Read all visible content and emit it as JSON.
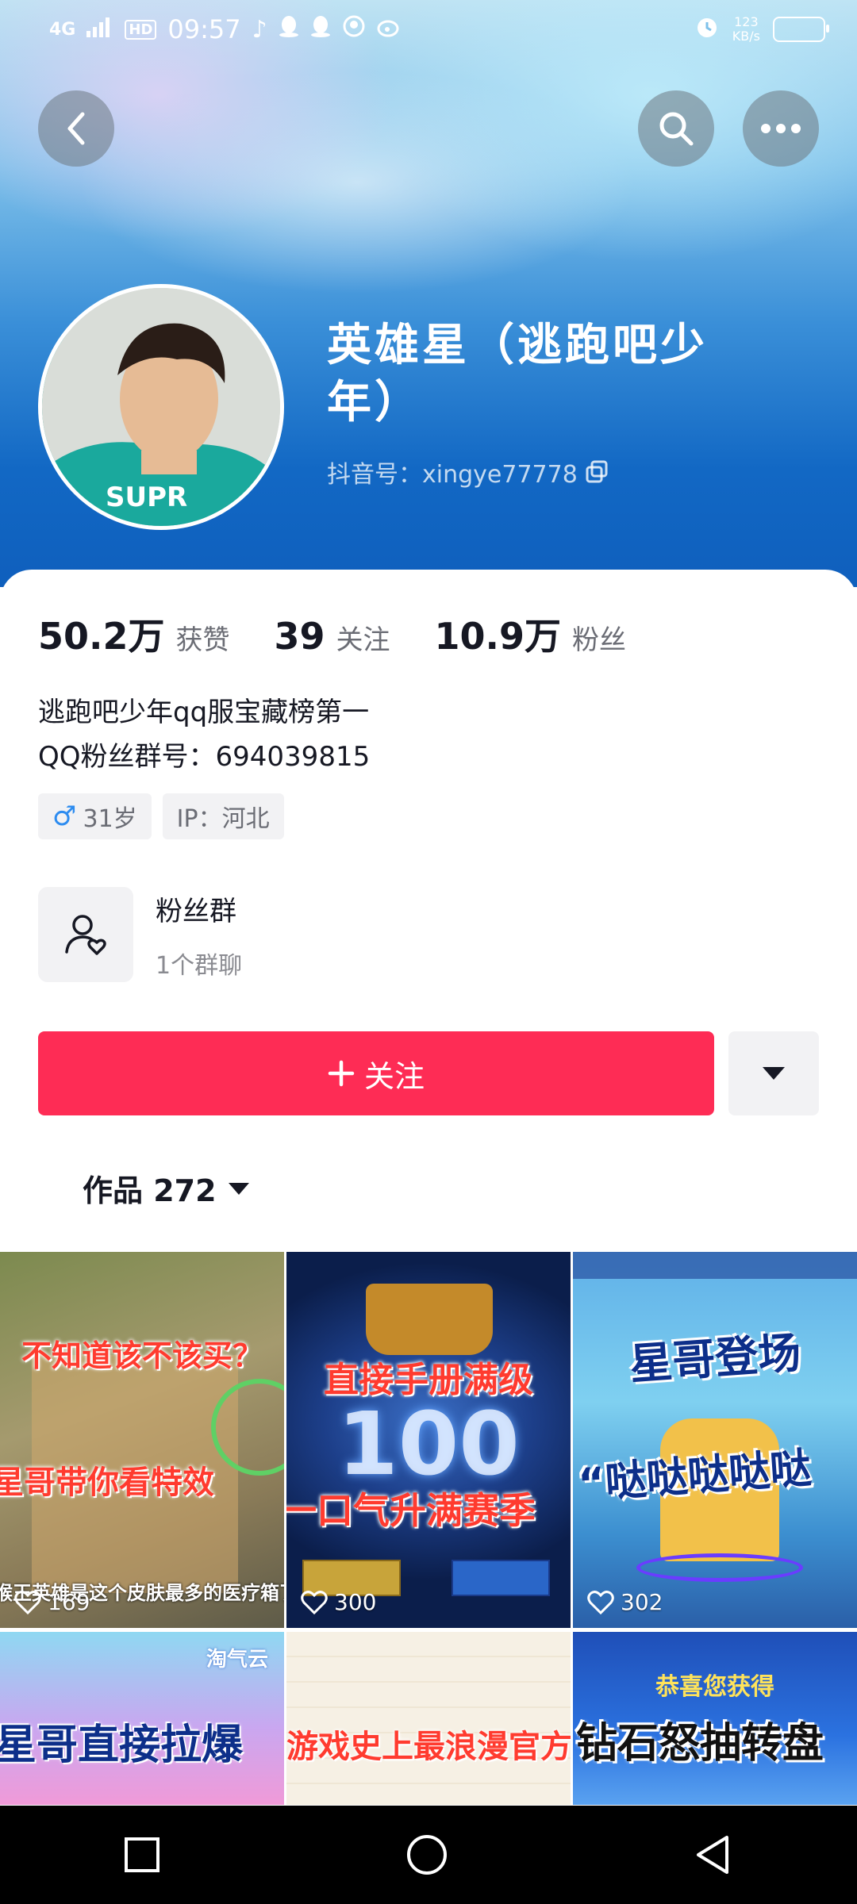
{
  "status_bar": {
    "network": "4G",
    "hd": "HD",
    "time": "09:57",
    "speed": "123\nKB/s"
  },
  "profile": {
    "name": "英雄星（逃跑吧少年）",
    "douyin_id": "抖音号：xingye77778"
  },
  "stats": [
    {
      "num": "50.2万",
      "label": "获赞"
    },
    {
      "num": "39",
      "label": "关注"
    },
    {
      "num": "10.9万",
      "label": "粉丝"
    }
  ],
  "bio": {
    "line1": "逃跑吧少年qq服宝藏榜第一",
    "line2": "QQ粉丝群号：694039815"
  },
  "tags": {
    "gender_age": "31岁",
    "ip": "IP：河北"
  },
  "fan_group": {
    "title": "粉丝群",
    "subtitle": "1个群聊"
  },
  "follow_button": "关注",
  "works_tab": "作品 272",
  "videos": [
    {
      "caption1": "不知道该不该买？",
      "caption2": "星哥带你看特效",
      "caption3": "猴王英雄是这个皮肤最多的医疗箱了",
      "likes": "169"
    },
    {
      "caption1": "直接手册满级",
      "caption2": "一口气升满赛季",
      "badge": "100",
      "likes": "300"
    },
    {
      "caption1": "星哥登场",
      "caption2": "“哒哒哒哒哒",
      "likes": "302"
    },
    {
      "caption1": "星哥直接拉爆",
      "label": "淘气云"
    },
    {
      "caption1": "游戏史上最浪漫官方"
    },
    {
      "caption1": "钻石怒抽转盘",
      "label": "恭喜您获得"
    }
  ],
  "colors": {
    "accent": "#fe2c55",
    "banner_blue": "#1268c4"
  }
}
